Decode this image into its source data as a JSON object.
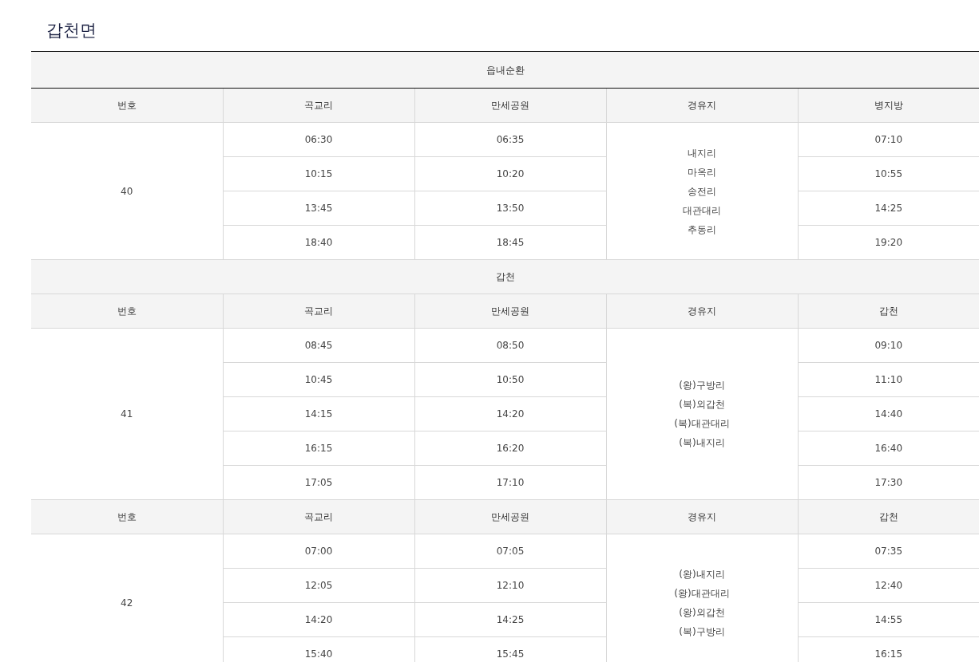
{
  "title": "갑천면",
  "groups": [
    {
      "title": "읍내순환",
      "routes": [
        {
          "headers": [
            "번호",
            "곡교리",
            "만세공원",
            "경유지",
            "병지방"
          ],
          "number": "40",
          "via": [
            "내지리",
            "마옥리",
            "송전리",
            "대관대리",
            "추동리"
          ],
          "times": [
            [
              "06:30",
              "06:35",
              "07:10"
            ],
            [
              "10:15",
              "10:20",
              "10:55"
            ],
            [
              "13:45",
              "13:50",
              "14:25"
            ],
            [
              "18:40",
              "18:45",
              "19:20"
            ]
          ]
        }
      ]
    },
    {
      "title": "갑천",
      "routes": [
        {
          "headers": [
            "번호",
            "곡교리",
            "만세공원",
            "경유지",
            "갑천"
          ],
          "number": "41",
          "via": [
            "(왕)구방리",
            "(복)외갑천",
            "(복)대관대리",
            "(복)내지리"
          ],
          "times": [
            [
              "08:45",
              "08:50",
              "09:10"
            ],
            [
              "10:45",
              "10:50",
              "11:10"
            ],
            [
              "14:15",
              "14:20",
              "14:40"
            ],
            [
              "16:15",
              "16:20",
              "16:40"
            ],
            [
              "17:05",
              "17:10",
              "17:30"
            ]
          ]
        },
        {
          "headers": [
            "번호",
            "곡교리",
            "만세공원",
            "경유지",
            "갑천"
          ],
          "number": "42",
          "via": [
            "(왕)내지리",
            "(왕)대관대리",
            "(왕)외갑천",
            "(복)구방리"
          ],
          "times": [
            [
              "07:00",
              "07:05",
              "07:35"
            ],
            [
              "12:05",
              "12:10",
              "12:40"
            ],
            [
              "14:20",
              "14:25",
              "14:55"
            ],
            [
              "15:40",
              "15:45",
              "16:15"
            ]
          ]
        }
      ]
    }
  ]
}
